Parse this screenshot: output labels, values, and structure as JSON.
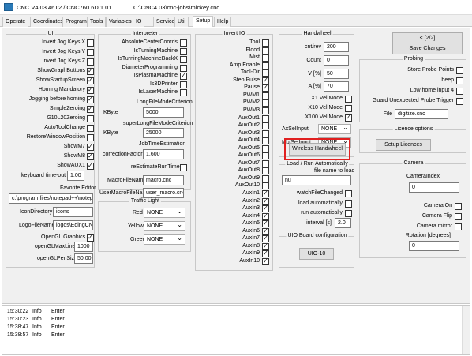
{
  "window": {
    "title": "CNC V4.03.46T2 / CNC760 6D 1.01",
    "path": "C:\\CNC4.03\\cnc-jobs\\mickey.cnc"
  },
  "menu": [
    "Operate",
    "Coordinates",
    "Program",
    "Tools",
    "Variables",
    "IO",
    "Service",
    "Util",
    "Setup",
    "Help"
  ],
  "ui": {
    "title": "UI",
    "checks": [
      {
        "label": "Invert Jog Keys X",
        "on": false
      },
      {
        "label": "Invert Jog Keys Y",
        "on": false
      },
      {
        "label": "Invert Jog Keys Z",
        "on": false
      },
      {
        "label": "ShowGraphButtons",
        "on": true
      },
      {
        "label": "ShowStartupScreen",
        "on": true
      },
      {
        "label": "Homing Mandatory",
        "on": true
      },
      {
        "label": "Jogging before homing",
        "on": true
      },
      {
        "label": "SimpleZeroing",
        "on": true
      },
      {
        "label": "G10L20Zeroing",
        "on": false
      },
      {
        "label": "AutoToolChange",
        "on": false
      },
      {
        "label": "RestoreWindowPosition",
        "on": false
      },
      {
        "label": "ShowM7",
        "on": true
      },
      {
        "label": "ShowM8",
        "on": true
      },
      {
        "label": "ShowAUX1",
        "on": true
      }
    ],
    "keyboard_timeout_label": "keyboard time-out",
    "keyboard_timeout": "1.00",
    "favorite_editor_label": "Favorite Editor",
    "favorite_editor": "c:\\program files\\notepad++\\notepad",
    "icon_dir_label": "IconDirectory",
    "icon_dir": "icons",
    "logo_label": "LogoFileName",
    "logo": "logos\\EdingCNCL",
    "opengl_label": "OpenGL Graphics",
    "opengl_on": true,
    "maxlines_label": "openGLMaxLines",
    "maxlines": "1000",
    "pensize_label": "openGLPenSize",
    "pensize": "50.00"
  },
  "interp": {
    "title": "Interpreter",
    "checks": [
      {
        "label": "AbsoluteCenterCoords",
        "on": false
      },
      {
        "label": "IsTurningMachine",
        "on": false
      },
      {
        "label": "IsTurningMachineBackX",
        "on": false
      },
      {
        "label": "DiameterProgramming",
        "on": false
      },
      {
        "label": "IsPlasmaMachine",
        "on": true
      },
      {
        "label": "Is3DPrinter",
        "on": false
      },
      {
        "label": "IsLaserMachine",
        "on": false
      }
    ],
    "lfm_title": "LongFileModeCriterion",
    "lfm_kbyte_label": "KByte",
    "lfm_kbyte": "5000",
    "slfm_title": "superLongFileModeCriterion",
    "slfm_kbyte_label": "KByte",
    "slfm_kbyte": "25000",
    "jte_title": "JobTimeEstimation",
    "cf_label": "correctionFactor",
    "cf": "1.600",
    "rert_label": "reEstimateRunTime",
    "rert_on": false,
    "macro_label": "MacroFileName",
    "macro": "macro.cnc",
    "umacro_label": "UserMacroFileName",
    "umacro": "user_macro.cnc"
  },
  "traffic": {
    "title": "Traffic Light",
    "rows": [
      {
        "label": "Red",
        "value": "NONE"
      },
      {
        "label": "Yellow",
        "value": "NONE"
      },
      {
        "label": "Green",
        "value": "NONE"
      }
    ]
  },
  "invert_io": {
    "title": "Invert IO",
    "items": [
      {
        "label": "Tool",
        "on": false
      },
      {
        "label": "Flood",
        "on": false
      },
      {
        "label": "Mist",
        "on": false
      },
      {
        "label": "Amp Enable",
        "on": false
      },
      {
        "label": "Tool-Dir",
        "on": false
      },
      {
        "label": "Step Pulse",
        "on": true
      },
      {
        "label": "Pause",
        "on": true
      },
      {
        "label": "PWM1",
        "on": false
      },
      {
        "label": "PWM2",
        "on": false
      },
      {
        "label": "PWM3",
        "on": false
      },
      {
        "label": "AuxOut1",
        "on": false
      },
      {
        "label": "AuxOut2",
        "on": false
      },
      {
        "label": "AuxOut3",
        "on": false
      },
      {
        "label": "AuxOut4",
        "on": false
      },
      {
        "label": "AuxOut5",
        "on": false
      },
      {
        "label": "AuxOut6",
        "on": false
      },
      {
        "label": "AuxOut7",
        "on": false
      },
      {
        "label": "AuxOut8",
        "on": false
      },
      {
        "label": "AuxOut9",
        "on": false
      },
      {
        "label": "AuxOut10",
        "on": false
      },
      {
        "label": "AuxIn1",
        "on": true
      },
      {
        "label": "AuxIn2",
        "on": true
      },
      {
        "label": "AuxIn3",
        "on": true
      },
      {
        "label": "AuxIn4",
        "on": true
      },
      {
        "label": "AuxIn5",
        "on": true
      },
      {
        "label": "AuxIn6",
        "on": true
      },
      {
        "label": "AuxIn7",
        "on": true
      },
      {
        "label": "AuxIn8",
        "on": true
      },
      {
        "label": "AuxIn9",
        "on": true
      },
      {
        "label": "AuxIn10",
        "on": true
      }
    ]
  },
  "handwheel": {
    "title": "Handwheel",
    "fields": [
      {
        "label": "cnt/rev",
        "value": "200"
      },
      {
        "label": "Count",
        "value": "0"
      },
      {
        "label": "V [%]",
        "value": "50"
      },
      {
        "label": "A [%]",
        "value": "70"
      }
    ],
    "vel": [
      {
        "label": "X1 Vel Mode",
        "on": false
      },
      {
        "label": "X10 Vel Mode",
        "on": false
      },
      {
        "label": "X100 Vel Mode",
        "on": true
      }
    ],
    "axsel_label": "AxSelInput",
    "axsel": "NONE",
    "mulsel_label": "MulSelInput",
    "mulsel": "NONE",
    "wireless_button": "Wireless Handwheel"
  },
  "load": {
    "title": "Load / Run Automatically",
    "file_label": "file name to load",
    "file": "nu",
    "checks": [
      {
        "label": "watchFileChanged",
        "on": false
      },
      {
        "label": "load automatically",
        "on": false
      },
      {
        "label": "run automatically",
        "on": false
      }
    ],
    "interval_label": "interval [s]",
    "interval": "2.0"
  },
  "uio": {
    "title": "UIO Board configuration",
    "button": "UIO-10"
  },
  "right": {
    "page_button": "< [2/2]",
    "save_button": "Save Changes"
  },
  "probing": {
    "title": "Probing",
    "checks": [
      {
        "label": "Store Probe Points",
        "on": false
      },
      {
        "label": "beep",
        "on": false
      },
      {
        "label": "Low home input 4",
        "on": false
      },
      {
        "label": "Guard Unexpected Probe Trigger",
        "on": false
      }
    ],
    "file_label": "File",
    "file": "digitize.cnc"
  },
  "licence": {
    "title": "Licence options",
    "button": "Setup Licences"
  },
  "camera": {
    "title": "Camera",
    "index_label": "CameraIndex",
    "index": "0",
    "checks": [
      {
        "label": "Camera On",
        "on": false
      },
      {
        "label": "Camera Flip",
        "on": false
      },
      {
        "label": "Camera mirror",
        "on": false
      }
    ],
    "rotation_label": "Rotation [degrees]",
    "rotation": "0"
  },
  "log": [
    {
      "time": "15:30:22",
      "level": "Info",
      "msg": "Enter"
    },
    {
      "time": "15:30:23",
      "level": "Info",
      "msg": "Enter"
    },
    {
      "time": "15:38:47",
      "level": "Info",
      "msg": "Enter"
    },
    {
      "time": "15:38:57",
      "level": "Info",
      "msg": "Enter"
    }
  ],
  "colors": {
    "highlight": "#e02020",
    "panel": "#f0f0f0"
  }
}
